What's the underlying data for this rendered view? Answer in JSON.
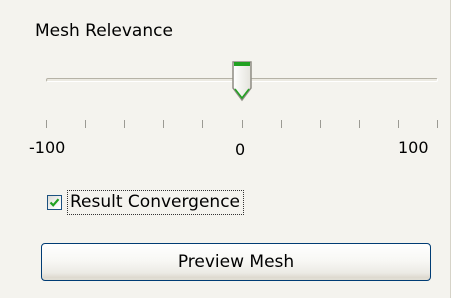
{
  "mesh_relevance": {
    "label": "Mesh Relevance",
    "slider": {
      "min": -100,
      "max": 100,
      "value": 0,
      "tick_step": 20,
      "min_label": "-100",
      "mid_label": "0",
      "max_label": "100"
    }
  },
  "result_convergence": {
    "label": "Result Convergence",
    "checked": true
  },
  "preview_button": {
    "label": "Preview Mesh"
  },
  "colors": {
    "panel_background": "#f4f3ee",
    "checkmark": "#21a121",
    "button_border": "#003c74",
    "thumb_accent": "#21a121"
  },
  "icons": {
    "slider_thumb": "slider-thumb-icon",
    "checkmark": "checkmark-icon"
  }
}
